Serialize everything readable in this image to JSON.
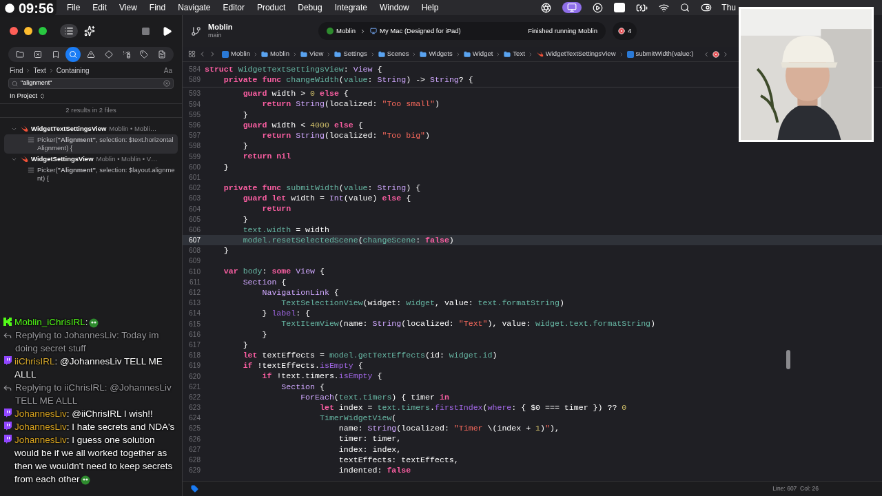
{
  "stream_clock": "09:56",
  "menu_bar": {
    "items": [
      "File",
      "Edit",
      "View",
      "Find",
      "Navigate",
      "Editor",
      "Product",
      "Debug",
      "Integrate",
      "Window",
      "Help"
    ],
    "clock": "Thu"
  },
  "window": {
    "project": "Moblin",
    "branch": "main",
    "scheme": "Moblin",
    "destination": "My Mac (Designed for iPad)",
    "status": "Finished running Moblin",
    "error_count": "4"
  },
  "navigator": {
    "tabs": [
      {
        "kind": "folder",
        "selected": false
      },
      {
        "kind": "source-control",
        "selected": false
      },
      {
        "kind": "bookmark",
        "selected": false
      },
      {
        "kind": "search",
        "selected": true
      },
      {
        "kind": "issue",
        "selected": false
      },
      {
        "kind": "test",
        "selected": false
      },
      {
        "kind": "debug",
        "selected": false
      },
      {
        "kind": "breakpoint",
        "selected": false
      },
      {
        "kind": "report",
        "selected": false
      }
    ],
    "find_path": [
      "Find",
      "Text",
      "Containing"
    ],
    "case_toggle": "Aa",
    "query": "\"alignment\"",
    "scope": "In Project",
    "summary": "2 results in 2 files",
    "results": [
      {
        "file": "WidgetTextSettingsView",
        "path": "Moblin • Mobli…",
        "expanded": true,
        "children": [
          {
            "match": "Picker(**\"Alignment\"**, selection: $text.horizontalAlignment) {",
            "selected": true
          }
        ]
      },
      {
        "file": "WidgetSettingsView",
        "path": "Moblin • Moblin • V…",
        "expanded": true,
        "children": [
          {
            "match": "Picker(**\"Alignment\"**, selection: $layout.alignment) {",
            "selected": false
          }
        ]
      }
    ]
  },
  "breadcrumb": [
    {
      "kind": "project",
      "label": "Moblin"
    },
    {
      "kind": "folder",
      "label": "Moblin"
    },
    {
      "kind": "folder",
      "label": "View"
    },
    {
      "kind": "folder",
      "label": "Settings"
    },
    {
      "kind": "folder",
      "label": "Scenes"
    },
    {
      "kind": "folder",
      "label": "Widgets"
    },
    {
      "kind": "folder",
      "label": "Widget"
    },
    {
      "kind": "folder",
      "label": "Text"
    },
    {
      "kind": "swift",
      "label": "WidgetTextSettingsView"
    },
    {
      "kind": "method",
      "label": "submitWidth(value:)"
    }
  ],
  "sticky_lines": [
    {
      "n": "584",
      "tokens": [
        {
          "kind": "k",
          "text": "struct "
        },
        {
          "kind": "f",
          "text": "WidgetTextSettingsView"
        },
        {
          "kind": "p",
          "text": ": "
        },
        {
          "kind": "t",
          "text": "View"
        },
        {
          "kind": "p",
          "text": " {"
        }
      ]
    },
    {
      "n": "589",
      "tokens": [
        {
          "kind": "k",
          "text": "    private func "
        },
        {
          "kind": "f",
          "text": "changeWidth"
        },
        {
          "kind": "p",
          "text": "("
        },
        {
          "kind": "f",
          "text": "value"
        },
        {
          "kind": "p",
          "text": ": "
        },
        {
          "kind": "t",
          "text": "String"
        },
        {
          "kind": "p",
          "text": ") -> "
        },
        {
          "kind": "t",
          "text": "String"
        },
        {
          "kind": "p",
          "text": "? {"
        }
      ]
    }
  ],
  "code_lines": [
    {
      "n": "593",
      "current": false,
      "tokens": [
        {
          "kind": "k",
          "text": "        guard "
        },
        {
          "kind": "p",
          "text": "width > "
        },
        {
          "kind": "n",
          "text": "0"
        },
        {
          "kind": "k",
          "text": " else"
        },
        {
          "kind": "p",
          "text": " {"
        }
      ]
    },
    {
      "n": "594",
      "current": false,
      "tokens": [
        {
          "kind": "k",
          "text": "            return "
        },
        {
          "kind": "t",
          "text": "String"
        },
        {
          "kind": "p",
          "text": "(localized: "
        },
        {
          "kind": "s",
          "text": "\"Too small\""
        },
        {
          "kind": "p",
          "text": ")"
        }
      ]
    },
    {
      "n": "595",
      "current": false,
      "tokens": [
        {
          "kind": "p",
          "text": "        }"
        }
      ]
    },
    {
      "n": "596",
      "current": false,
      "tokens": [
        {
          "kind": "k",
          "text": "        guard "
        },
        {
          "kind": "p",
          "text": "width < "
        },
        {
          "kind": "n",
          "text": "4000"
        },
        {
          "kind": "k",
          "text": " else"
        },
        {
          "kind": "p",
          "text": " {"
        }
      ]
    },
    {
      "n": "597",
      "current": false,
      "tokens": [
        {
          "kind": "k",
          "text": "            return "
        },
        {
          "kind": "t",
          "text": "String"
        },
        {
          "kind": "p",
          "text": "(localized: "
        },
        {
          "kind": "s",
          "text": "\"Too big\""
        },
        {
          "kind": "p",
          "text": ")"
        }
      ]
    },
    {
      "n": "598",
      "current": false,
      "tokens": [
        {
          "kind": "p",
          "text": "        }"
        }
      ]
    },
    {
      "n": "599",
      "current": false,
      "tokens": [
        {
          "kind": "k",
          "text": "        return nil"
        }
      ]
    },
    {
      "n": "600",
      "current": false,
      "tokens": [
        {
          "kind": "p",
          "text": "    }"
        }
      ]
    },
    {
      "n": "601",
      "current": false
    },
    {
      "n": "602",
      "current": false,
      "tokens": [
        {
          "kind": "k",
          "text": "    private func "
        },
        {
          "kind": "f",
          "text": "submitWidth"
        },
        {
          "kind": "p",
          "text": "("
        },
        {
          "kind": "f",
          "text": "value"
        },
        {
          "kind": "p",
          "text": ": "
        },
        {
          "kind": "t",
          "text": "String"
        },
        {
          "kind": "p",
          "text": ") {"
        }
      ]
    },
    {
      "n": "603",
      "current": false,
      "tokens": [
        {
          "kind": "k",
          "text": "        guard let "
        },
        {
          "kind": "p",
          "text": "width = "
        },
        {
          "kind": "t",
          "text": "Int"
        },
        {
          "kind": "p",
          "text": "(value) "
        },
        {
          "kind": "k",
          "text": "else"
        },
        {
          "kind": "p",
          "text": " {"
        }
      ]
    },
    {
      "n": "604",
      "current": false,
      "tokens": [
        {
          "kind": "k",
          "text": "            return"
        }
      ]
    },
    {
      "n": "605",
      "current": false,
      "tokens": [
        {
          "kind": "p",
          "text": "        }"
        }
      ]
    },
    {
      "n": "606",
      "current": false,
      "tokens": [
        {
          "kind": "f",
          "text": "        text.width"
        },
        {
          "kind": "p",
          "text": " = width"
        }
      ]
    },
    {
      "n": "607",
      "current": true,
      "tokens": [
        {
          "kind": "f",
          "text": "        model.resetSelectedScene"
        },
        {
          "kind": "p",
          "text": "("
        },
        {
          "kind": "f",
          "text": "changeScene"
        },
        {
          "kind": "p",
          "text": ": "
        },
        {
          "kind": "k",
          "text": "false"
        },
        {
          "kind": "p",
          "text": ")"
        }
      ]
    },
    {
      "n": "608",
      "current": false,
      "tokens": [
        {
          "kind": "p",
          "text": "    }"
        }
      ]
    },
    {
      "n": "609",
      "current": false
    },
    {
      "n": "610",
      "current": false,
      "tokens": [
        {
          "kind": "k",
          "text": "    var "
        },
        {
          "kind": "f",
          "text": "body"
        },
        {
          "kind": "p",
          "text": ": "
        },
        {
          "kind": "k",
          "text": "some "
        },
        {
          "kind": "t",
          "text": "View"
        },
        {
          "kind": "p",
          "text": " {"
        }
      ]
    },
    {
      "n": "611",
      "current": false,
      "tokens": [
        {
          "kind": "t",
          "text": "        Section"
        },
        {
          "kind": "p",
          "text": " {"
        }
      ]
    },
    {
      "n": "612",
      "current": false,
      "tokens": [
        {
          "kind": "t",
          "text": "            NavigationLink"
        },
        {
          "kind": "p",
          "text": " {"
        }
      ]
    },
    {
      "n": "613",
      "current": false,
      "tokens": [
        {
          "kind": "f",
          "text": "                TextSelectionView"
        },
        {
          "kind": "p",
          "text": "(widget: "
        },
        {
          "kind": "f",
          "text": "widget"
        },
        {
          "kind": "p",
          "text": ", value: "
        },
        {
          "kind": "f",
          "text": "text.formatString"
        },
        {
          "kind": "p",
          "text": ")"
        }
      ]
    },
    {
      "n": "614",
      "current": false,
      "tokens": [
        {
          "kind": "p",
          "text": "            } "
        },
        {
          "kind": "m",
          "text": "label"
        },
        {
          "kind": "p",
          "text": ": {"
        }
      ]
    },
    {
      "n": "615",
      "current": false,
      "tokens": [
        {
          "kind": "f",
          "text": "                TextItemView"
        },
        {
          "kind": "p",
          "text": "(name: "
        },
        {
          "kind": "t",
          "text": "String"
        },
        {
          "kind": "p",
          "text": "(localized: "
        },
        {
          "kind": "s",
          "text": "\"Text\""
        },
        {
          "kind": "p",
          "text": "), value: "
        },
        {
          "kind": "f",
          "text": "widget.text.formatString"
        },
        {
          "kind": "p",
          "text": ")"
        }
      ]
    },
    {
      "n": "616",
      "current": false,
      "tokens": [
        {
          "kind": "p",
          "text": "            }"
        }
      ]
    },
    {
      "n": "617",
      "current": false,
      "tokens": [
        {
          "kind": "p",
          "text": "        }"
        }
      ]
    },
    {
      "n": "618",
      "current": false,
      "tokens": [
        {
          "kind": "k",
          "text": "        let "
        },
        {
          "kind": "p",
          "text": "textEffects = "
        },
        {
          "kind": "f",
          "text": "model.getTextEffects"
        },
        {
          "kind": "p",
          "text": "(id: "
        },
        {
          "kind": "f",
          "text": "widget.id"
        },
        {
          "kind": "p",
          "text": ")"
        }
      ]
    },
    {
      "n": "619",
      "current": false,
      "tokens": [
        {
          "kind": "k",
          "text": "        if "
        },
        {
          "kind": "p",
          "text": "!textEffects."
        },
        {
          "kind": "m",
          "text": "isEmpty"
        },
        {
          "kind": "p",
          "text": " {"
        }
      ]
    },
    {
      "n": "620",
      "current": false,
      "tokens": [
        {
          "kind": "k",
          "text": "            if "
        },
        {
          "kind": "p",
          "text": "!text.timers."
        },
        {
          "kind": "m",
          "text": "isEmpty"
        },
        {
          "kind": "p",
          "text": " {"
        }
      ]
    },
    {
      "n": "621",
      "current": false,
      "tokens": [
        {
          "kind": "t",
          "text": "                Section"
        },
        {
          "kind": "p",
          "text": " {"
        }
      ]
    },
    {
      "n": "622",
      "current": false,
      "tokens": [
        {
          "kind": "t",
          "text": "                    ForEach"
        },
        {
          "kind": "p",
          "text": "("
        },
        {
          "kind": "f",
          "text": "text.timers"
        },
        {
          "kind": "p",
          "text": ") { timer "
        },
        {
          "kind": "k",
          "text": "in"
        }
      ]
    },
    {
      "n": "623",
      "current": false,
      "tokens": [
        {
          "kind": "k",
          "text": "                        let "
        },
        {
          "kind": "p",
          "text": "index = "
        },
        {
          "kind": "f",
          "text": "text.timers"
        },
        {
          "kind": "p",
          "text": "."
        },
        {
          "kind": "m",
          "text": "firstIndex"
        },
        {
          "kind": "p",
          "text": "("
        },
        {
          "kind": "m",
          "text": "where"
        },
        {
          "kind": "p",
          "text": ": { $0 === timer }) ?? "
        },
        {
          "kind": "n",
          "text": "0"
        }
      ]
    },
    {
      "n": "624",
      "current": false,
      "tokens": [
        {
          "kind": "f",
          "text": "                        TimerWidgetView"
        },
        {
          "kind": "p",
          "text": "("
        }
      ]
    },
    {
      "n": "625",
      "current": false,
      "tokens": [
        {
          "kind": "p",
          "text": "                            name: "
        },
        {
          "kind": "t",
          "text": "String"
        },
        {
          "kind": "p",
          "text": "(localized: "
        },
        {
          "kind": "s",
          "text": "\"Timer "
        },
        {
          "kind": "p",
          "text": "\\(index + "
        },
        {
          "kind": "n",
          "text": "1"
        },
        {
          "kind": "p",
          "text": ")"
        },
        {
          "kind": "s",
          "text": "\""
        },
        {
          "kind": "p",
          "text": "),"
        }
      ]
    },
    {
      "n": "626",
      "current": false,
      "tokens": [
        {
          "kind": "p",
          "text": "                            timer: timer,"
        }
      ]
    },
    {
      "n": "627",
      "current": false,
      "tokens": [
        {
          "kind": "p",
          "text": "                            index: index,"
        }
      ]
    },
    {
      "n": "628",
      "current": false,
      "tokens": [
        {
          "kind": "p",
          "text": "                            textEffects: textEffects,"
        }
      ]
    },
    {
      "n": "629",
      "current": false,
      "tokens": [
        {
          "kind": "p",
          "text": "                            indented: "
        },
        {
          "kind": "k",
          "text": "false"
        }
      ]
    }
  ],
  "status_bar": {
    "position": "Line: 607  Col: 26"
  },
  "chat": [
    {
      "kind": "kick-message",
      "user": "Moblin_iChrisIRL",
      "color": "#53fc18",
      "text": ":",
      "emote": true
    },
    {
      "kind": "reply",
      "text": "Replying to JohannesLiv: Today im doing secret stuff"
    },
    {
      "kind": "twitch-message",
      "user": "iiChrisIRL",
      "color": "#d4a72c",
      "text": ": @JohannesLiv TELL ME ALLL",
      "emote": false
    },
    {
      "kind": "reply",
      "text": "Replying to iiChrisIRL: @JohannesLiv TELL ME ALLL"
    },
    {
      "kind": "twitch-message",
      "user": "JohannesLiv",
      "color": "#daa520",
      "text": ": @iiChrisIRL I wish!!",
      "emote": false
    },
    {
      "kind": "twitch-message",
      "user": "JohannesLiv",
      "color": "#daa520",
      "text": ": I hate secrets and NDA's",
      "emote": false
    },
    {
      "kind": "twitch-message",
      "user": "JohannesLiv",
      "color": "#daa520",
      "text": ": I guess one solution would be if we all worked together as then we wouldn't need to keep secrets from each other",
      "emote": true
    }
  ]
}
